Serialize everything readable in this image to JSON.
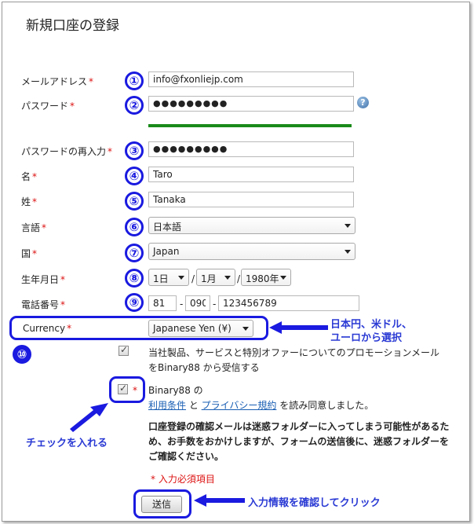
{
  "form": {
    "title": "新規口座の登録",
    "required_mark": "*",
    "email": {
      "label": "メールアドレス",
      "value": "info@fxonliejp.com"
    },
    "password": {
      "label": "パスワード",
      "value": "●●●●●●●●●",
      "strength_color": "#1a8a1a"
    },
    "password_confirm": {
      "label": "パスワードの再入力",
      "value": "●●●●●●●●●"
    },
    "first_name": {
      "label": "名",
      "value": "Taro"
    },
    "last_name": {
      "label": "姓",
      "value": "Tanaka"
    },
    "language": {
      "label": "言語",
      "value": "日本語"
    },
    "country": {
      "label": "国",
      "value": "Japan"
    },
    "birthdate": {
      "label": "生年月日",
      "day": "1日",
      "month": "1月",
      "year": "1980年",
      "separator": "/"
    },
    "phone": {
      "label": "電話番号",
      "part1": "81",
      "part2": "090",
      "part3": "123456789",
      "separator": "-"
    },
    "currency": {
      "label": "Currency",
      "value": "Japanese Yen (¥)"
    },
    "promo": {
      "text_line1": "当社製品、サービスと特別オファーについてのプロモーションメール",
      "text_line2": "をBinary88 から受信する",
      "checked": true
    },
    "terms": {
      "text_line1": "Binary88 の",
      "terms_link": "利用条件",
      "and": " と ",
      "privacy_link": "プライバシー規約",
      "agree": " を読み同意しました。",
      "checked": true
    },
    "notice": "口座登録の確認メールは迷惑フォルダーに入ってしまう可能性があるため、お手数をおかけしますが、フォームの送信後に、迷惑フォルダーをご確認ください。",
    "required_note": "*  入力必須項目",
    "submit_label": "送信"
  },
  "annotations": {
    "numbers": [
      "①",
      "②",
      "③",
      "④",
      "⑤",
      "⑥",
      "⑦",
      "⑧",
      "⑨",
      "⑩"
    ],
    "currency_note_line1": "日本円、米ドル、",
    "currency_note_line2": "ユーロから選択",
    "check_note": "チェックを入れる",
    "submit_note": "入力情報を確認してクリック",
    "accent_color": "#1a1ae0"
  }
}
